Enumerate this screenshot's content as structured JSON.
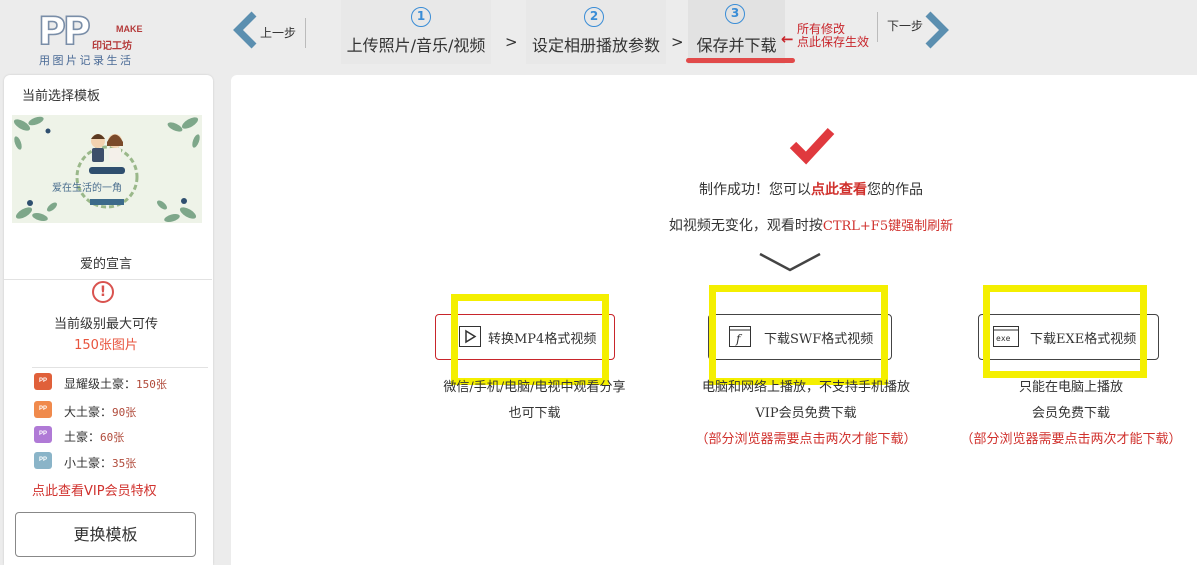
{
  "logo": {
    "text": "PP",
    "make": "MAKE",
    "yinji": "印记工坊",
    "slogan": "用图片记录生活"
  },
  "nav": {
    "prev_label": "上一步",
    "next_label": "下一步"
  },
  "steps": [
    {
      "number": "1",
      "label": "上传照片/音乐/视频"
    },
    {
      "number": "2",
      "label": "设定相册播放参数"
    },
    {
      "number": "3",
      "label": "保存并下载"
    }
  ],
  "step_separator": ">",
  "save_note": {
    "line1": "所有修改",
    "line2": "点此保存生效"
  },
  "sidebar": {
    "title": "当前选择模板",
    "template_name": "爱的宣言",
    "thumbnail_caption": "爱在生活的一角",
    "limit_label": "当前级别最大可传",
    "limit_value": "150张图片",
    "levels": [
      {
        "name": "显耀级土豪：",
        "value": "150张",
        "color": "#e0603a"
      },
      {
        "name": "大土豪：",
        "value": "90张",
        "color": "#f08a4c"
      },
      {
        "name": "土豪：",
        "value": "60张",
        "color": "#b07ad6"
      },
      {
        "name": "小土豪：",
        "value": "35张",
        "color": "#8ab4c8"
      }
    ],
    "vip_link": "点此查看VIP会员特权",
    "change_button": "更换模板"
  },
  "main": {
    "success_prefix": "制作成功！您可以",
    "success_link": "点此查看",
    "success_suffix": "您的作品",
    "refresh_prefix": "如视频无变化，观看时按",
    "refresh_key": "CTRL+F5键强制刷新",
    "downloads": [
      {
        "label": "转换MP4格式视频",
        "icon": "play-icon",
        "desc_lines": [
          "微信/手机/电脑/电视中观看分享",
          "也可下载"
        ]
      },
      {
        "label": "下载SWF格式视频",
        "icon": "flash-icon",
        "desc_lines": [
          "电脑和网络上播放，不支持手机播放",
          "VIP会员免费下载"
        ],
        "note": "（部分浏览器需要点击两次才能下载）"
      },
      {
        "label": "下载EXE格式视频",
        "icon": "exe-icon",
        "icon_text": "exe",
        "desc_lines": [
          "只能在电脑上播放",
          "会员免费下载"
        ],
        "note": "（部分浏览器需要点击两次才能下载）"
      }
    ]
  },
  "colors": {
    "accent_blue": "#3a8dd6",
    "accent_red": "#d0312d",
    "highlight_yellow": "#f4ef00",
    "check_red": "#e0393e"
  }
}
